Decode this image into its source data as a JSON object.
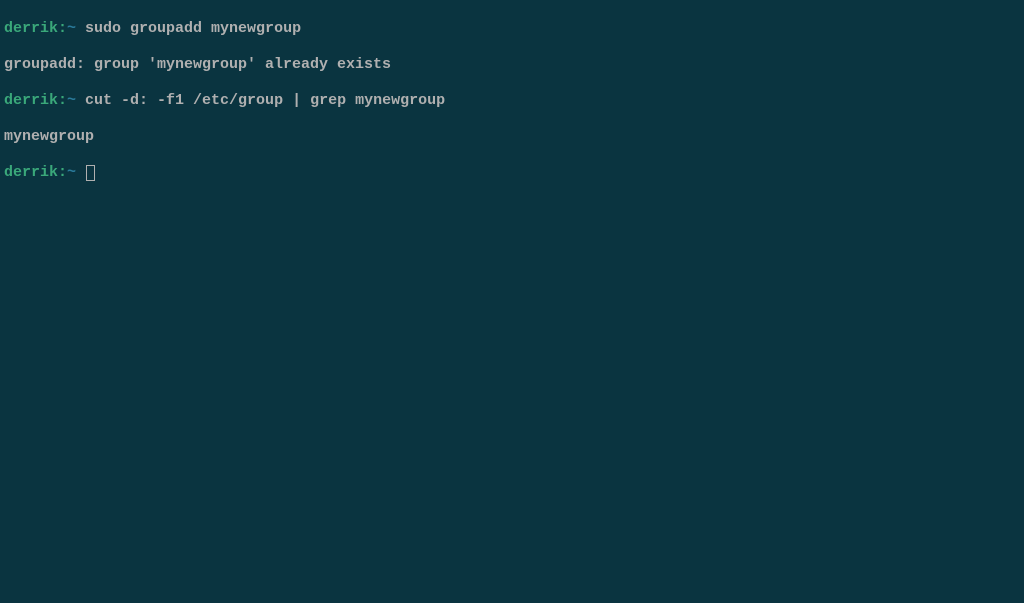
{
  "terminal": {
    "lines": [
      {
        "prompt_user": "derrik:",
        "prompt_tilde": "~",
        "command": " sudo groupadd mynewgroup"
      },
      {
        "output": "groupadd: group 'mynewgroup' already exists"
      },
      {
        "prompt_user": "derrik:",
        "prompt_tilde": "~",
        "command": " cut -d: -f1 /etc/group | grep mynewgroup"
      },
      {
        "output": "mynewgroup"
      },
      {
        "prompt_user": "derrik:",
        "prompt_tilde": "~",
        "command": " "
      }
    ]
  }
}
